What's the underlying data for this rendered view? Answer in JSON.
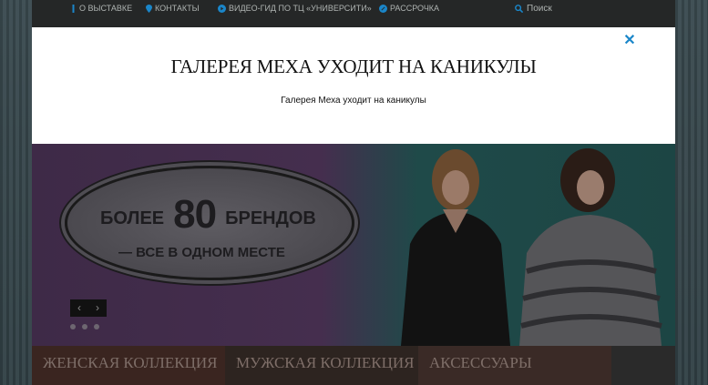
{
  "topnav": {
    "items": [
      {
        "label": "О выставке",
        "icon": "pin-icon"
      },
      {
        "label": "Контакты",
        "icon": "map-pin-icon"
      },
      {
        "label": "Видео-гид по ТЦ «Университи»",
        "icon": "play-circle-icon"
      },
      {
        "label": "Рассрочка",
        "icon": "percent-circle-icon"
      }
    ],
    "search_label": "Поиск"
  },
  "modal": {
    "title": "ГАЛЕРЕЯ МЕХА УХОДИТ НА КАНИКУЛЫ",
    "text": "Галерея Меха уходит на каникулы",
    "close_symbol": "✕"
  },
  "banner": {
    "line1_prefix": "БОЛЕЕ",
    "line1_number": "80",
    "line1_suffix": "БРЕНДОВ",
    "line2": "— ВСЕ В ОДНОМ МЕСТЕ",
    "prev_symbol": "‹",
    "next_symbol": "›"
  },
  "categories": [
    {
      "label": "Женская коллекция"
    },
    {
      "label": "Мужская коллекция"
    },
    {
      "label": "Аксессуары"
    }
  ],
  "colors": {
    "accent": "#1a86c9",
    "overlay": "#252727"
  }
}
